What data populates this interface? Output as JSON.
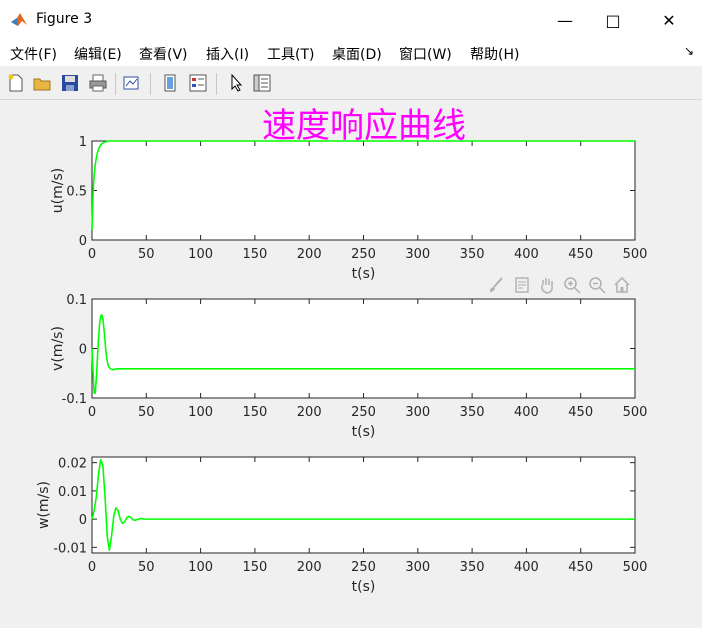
{
  "window": {
    "title": "Figure 3",
    "minimize_glyph": "—",
    "maximize_glyph": "□",
    "close_glyph": "✕"
  },
  "menu": {
    "items": [
      "文件(F)",
      "编辑(E)",
      "查看(V)",
      "插入(I)",
      "工具(T)",
      "桌面(D)",
      "窗口(W)",
      "帮助(H)"
    ],
    "overflow_glyph": "↘"
  },
  "toolbar": {
    "icons": [
      "new-figure-icon",
      "open-file-icon",
      "save-icon",
      "print-icon",
      "link-plot-icon",
      "colorbar-icon",
      "legend-icon",
      "pointer-icon",
      "property-inspector-icon"
    ]
  },
  "axes_toolbar": {
    "icons": [
      "brush-icon",
      "datatip-icon",
      "pan-icon",
      "zoom-in-icon",
      "zoom-out-icon",
      "home-icon"
    ]
  },
  "figure_title": "速度响应曲线",
  "colors": {
    "line": "#00ff00",
    "title": "#ff00ff",
    "axes_bg": "#ffffff"
  },
  "chart_data": [
    {
      "type": "line",
      "ylabel": "u(m/s)",
      "xlabel": "t(s)",
      "xlim": [
        0,
        500
      ],
      "ylim": [
        0,
        1
      ],
      "xticks": [
        0,
        50,
        100,
        150,
        200,
        250,
        300,
        350,
        400,
        450,
        500
      ],
      "yticks": [
        0,
        0.5,
        1
      ],
      "ytick_labels": [
        "0",
        "0.5",
        "1"
      ],
      "series": [
        {
          "x": [
            0,
            1,
            2,
            3,
            4,
            5,
            6,
            8,
            10,
            12,
            15,
            20,
            500
          ],
          "y": [
            0.1,
            0.48,
            0.66,
            0.76,
            0.83,
            0.88,
            0.92,
            0.96,
            0.98,
            0.99,
            1.0,
            1.0,
            1.0
          ]
        }
      ]
    },
    {
      "type": "line",
      "ylabel": "v(m/s)",
      "xlabel": "t(s)",
      "xlim": [
        0,
        500
      ],
      "ylim": [
        -0.1,
        0.1
      ],
      "xticks": [
        0,
        50,
        100,
        150,
        200,
        250,
        300,
        350,
        400,
        450,
        500
      ],
      "yticks": [
        -0.1,
        0,
        0.1
      ],
      "ytick_labels": [
        "-0.1",
        "0",
        "0.1"
      ],
      "series": [
        {
          "x": [
            0,
            1,
            2,
            3,
            4,
            5,
            6,
            7,
            8,
            9,
            10,
            11,
            12,
            13,
            14,
            15,
            17,
            19,
            21,
            23,
            25,
            30,
            500
          ],
          "y": [
            0.0,
            -0.05,
            -0.09,
            -0.09,
            -0.06,
            -0.02,
            0.02,
            0.05,
            0.065,
            0.068,
            0.06,
            0.04,
            0.015,
            -0.01,
            -0.025,
            -0.035,
            -0.041,
            -0.043,
            -0.042,
            -0.041,
            -0.041,
            -0.041,
            -0.041
          ]
        }
      ]
    },
    {
      "type": "line",
      "ylabel": "w(m/s)",
      "xlabel": "t(s)",
      "xlim": [
        0,
        500
      ],
      "ylim": [
        -0.012,
        0.022
      ],
      "xticks": [
        0,
        50,
        100,
        150,
        200,
        250,
        300,
        350,
        400,
        450,
        500
      ],
      "yticks": [
        -0.01,
        0,
        0.01,
        0.02
      ],
      "ytick_labels": [
        "-0.01",
        "0",
        "0.01",
        "0.02"
      ],
      "series": [
        {
          "x": [
            0,
            2,
            4,
            6,
            8,
            10,
            12,
            14,
            16,
            18,
            20,
            22,
            24,
            26,
            28,
            30,
            32,
            34,
            36,
            38,
            40,
            42,
            45,
            48,
            52,
            60,
            500
          ],
          "y": [
            0.0,
            0.003,
            0.008,
            0.016,
            0.021,
            0.019,
            0.008,
            -0.006,
            -0.011,
            -0.006,
            0.001,
            0.004,
            0.003,
            0.0,
            -0.0015,
            -0.001,
            0.0005,
            0.001,
            0.0005,
            -0.0003,
            -0.0004,
            -0.0001,
            0.0002,
            0.0,
            0.0,
            0.0,
            0.0
          ]
        }
      ]
    }
  ]
}
